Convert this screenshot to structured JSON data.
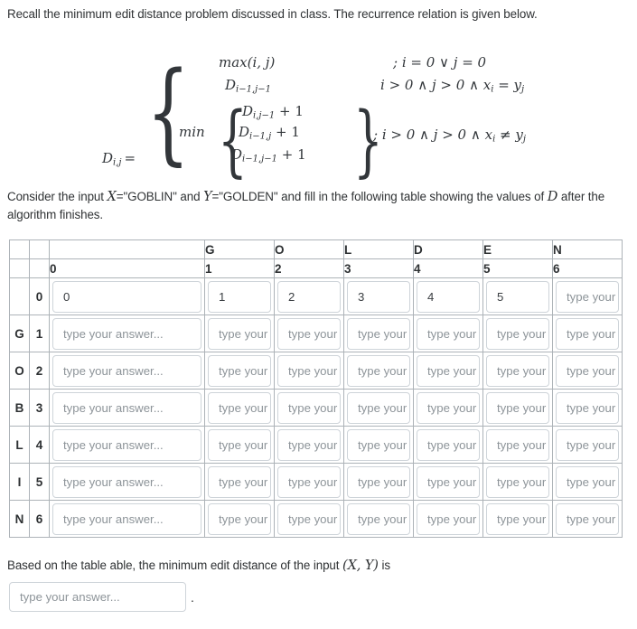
{
  "intro": {
    "text": "Recall the minimum edit distance problem discussed in class. The recurrence relation is given below."
  },
  "formula": {
    "lhs_symbol": "D",
    "lhs_sub": "i,j",
    "equals": "=",
    "min_label": "min",
    "cases": [
      {
        "expr": "max(i, j)",
        "condition": "; i = 0 ∨ j = 0"
      },
      {
        "expr": "D",
        "expr_sub": "i−1,j−1",
        "condition": "i > 0 ∧ j > 0 ∧ x",
        "condition_sub": "i",
        "condition_tail": " = y",
        "condition_tail_sub": "j"
      }
    ],
    "min_terms": [
      {
        "base": "D",
        "sub": "i,j−1",
        "tail": " + 1"
      },
      {
        "base": "D",
        "sub": "i−1,j",
        "tail": " + 1"
      },
      {
        "base": "D",
        "sub": "i−1,j−1",
        "tail": " + 1"
      }
    ],
    "min_condition": "; i > 0 ∧ j > 0 ∧ x",
    "min_condition_sub": "i",
    "min_condition_tail": " ≠ y",
    "min_condition_tail_sub": "j"
  },
  "consider": {
    "part1": "Consider the input ",
    "varX": "X",
    "part2": "=\"GOBLIN\" and ",
    "varY": "Y",
    "part3": "=\"GOLDEN\" and fill in the following table showing the values of ",
    "varD": "D",
    "part4": " after the algorithm finishes."
  },
  "table": {
    "column_letters": [
      "",
      "",
      "",
      "G",
      "O",
      "L",
      "D",
      "E",
      "N"
    ],
    "column_numbers": [
      "",
      "",
      "0",
      "1",
      "2",
      "3",
      "4",
      "5",
      "6"
    ],
    "row_letters": [
      "",
      "G",
      "O",
      "B",
      "L",
      "I",
      "N"
    ],
    "row_numbers": [
      "0",
      "1",
      "2",
      "3",
      "4",
      "5",
      "6"
    ],
    "placeholder": "type your answer...",
    "rows": [
      {
        "letter": "",
        "number": "0",
        "cells": [
          "0",
          "1",
          "2",
          "3",
          "4",
          "5",
          ""
        ]
      },
      {
        "letter": "G",
        "number": "1",
        "cells": [
          "",
          "",
          "",
          "",
          "",
          "",
          ""
        ]
      },
      {
        "letter": "O",
        "number": "2",
        "cells": [
          "",
          "",
          "",
          "",
          "",
          "",
          ""
        ]
      },
      {
        "letter": "B",
        "number": "3",
        "cells": [
          "",
          "",
          "",
          "",
          "",
          "",
          ""
        ]
      },
      {
        "letter": "L",
        "number": "4",
        "cells": [
          "",
          "",
          "",
          "",
          "",
          "",
          ""
        ]
      },
      {
        "letter": "I",
        "number": "5",
        "cells": [
          "",
          "",
          "",
          "",
          "",
          "",
          ""
        ]
      },
      {
        "letter": "N",
        "number": "6",
        "cells": [
          "",
          "",
          "",
          "",
          "",
          "",
          ""
        ]
      }
    ]
  },
  "footer": {
    "part1": "Based on the table able, the minimum edit distance of the input ",
    "math": "(X, Y)",
    "part2": " is",
    "placeholder": "type your answer...",
    "period": "."
  }
}
